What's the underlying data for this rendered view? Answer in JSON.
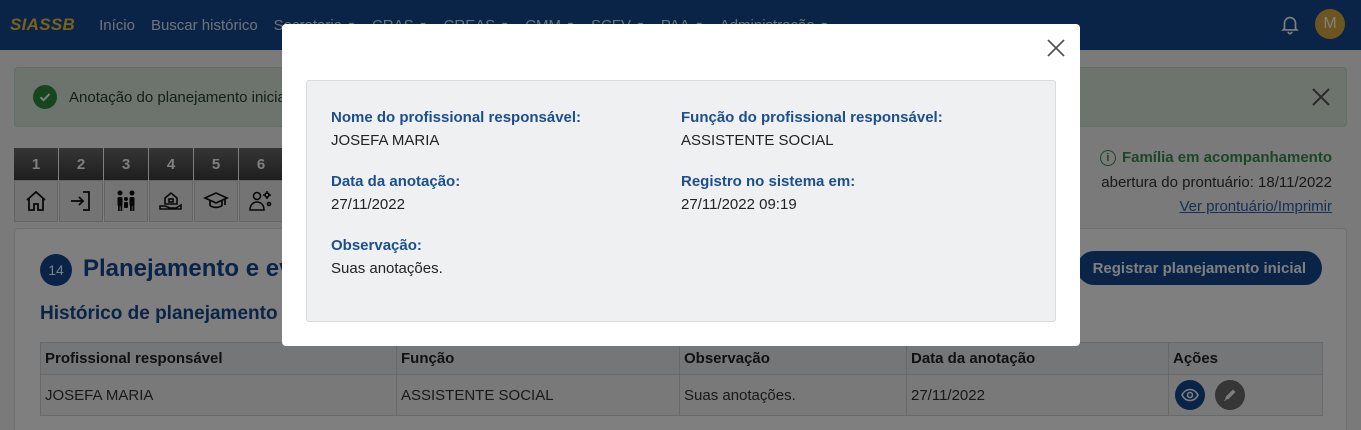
{
  "navbar": {
    "brand": "SIASSB",
    "links": [
      "Início",
      "Buscar histórico",
      "Secretaria",
      "CRAS",
      "CREAS",
      "CMM",
      "SCFV",
      "PAA",
      "Administração"
    ],
    "avatar_letter": "M",
    "bg_color": "#15498f",
    "brand_color": "#f0c23a"
  },
  "alert": {
    "text": "Anotação do planejamento inicial"
  },
  "steps": [
    {
      "num": "1",
      "icon": "home-icon"
    },
    {
      "num": "2",
      "icon": "sign-in-icon"
    },
    {
      "num": "3",
      "icon": "family-icon"
    },
    {
      "num": "4",
      "icon": "house-hand-icon"
    },
    {
      "num": "5",
      "icon": "graduation-cap-icon"
    },
    {
      "num": "6",
      "icon": "user-gear-icon"
    }
  ],
  "status": {
    "family_status": "Família em acompanhamento",
    "opening_date": "abertura do prontuário: 18/11/2022",
    "link": "Ver prontuário/Imprimir"
  },
  "section": {
    "number": "14",
    "title": "Planejamento e ev",
    "button": "Registrar planejamento inicial",
    "subtitle": "Histórico de planejamento"
  },
  "table": {
    "headers": [
      "Profissional responsável",
      "Função",
      "Observação",
      "Data da anotação",
      "Ações"
    ],
    "rows": [
      {
        "profissional": "JOSEFA MARIA",
        "funcao": "ASSISTENTE SOCIAL",
        "observacao": "Suas anotações.",
        "data": "27/11/2022"
      }
    ]
  },
  "modal": {
    "fields": {
      "nome_label": "Nome do profissional responsável:",
      "nome_value": "JOSEFA MARIA",
      "funcao_label": "Função do profissional responsável:",
      "funcao_value": "ASSISTENTE SOCIAL",
      "data_label": "Data da anotação:",
      "data_value": "27/11/2022",
      "registro_label": "Registro no sistema em:",
      "registro_value": "27/11/2022 09:19",
      "obs_label": "Observação:",
      "obs_value": "Suas anotações."
    }
  }
}
